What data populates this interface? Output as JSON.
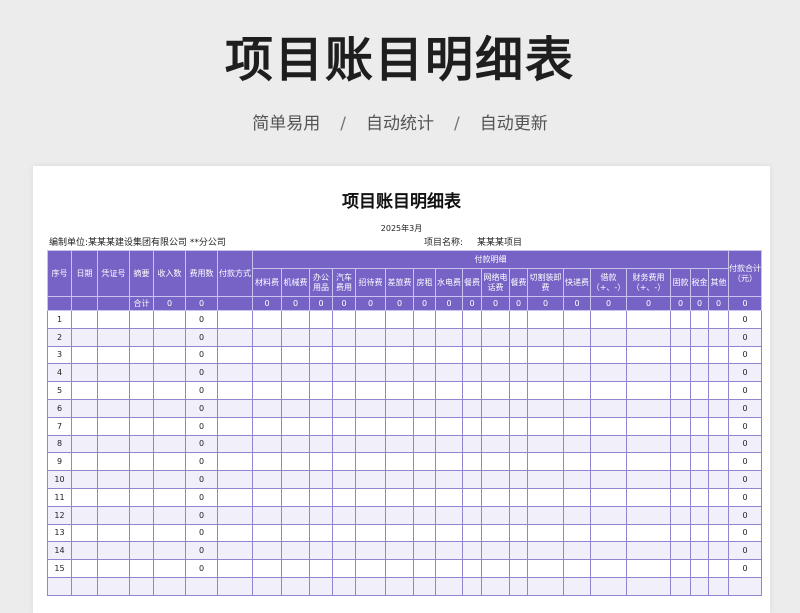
{
  "hero": {
    "title": "项目账目明细表",
    "tags": [
      "简单易用",
      "自动统计",
      "自动更新"
    ],
    "separator": "/"
  },
  "sheet": {
    "title": "项目账目明细表",
    "date": "2025年3月",
    "unit_label": "编制单位:某某某建设集团有限公司 **分公司",
    "project_label": "项目名称:",
    "project_value": "某某某项目"
  },
  "table": {
    "headers": {
      "seq": "序号",
      "date": "日期",
      "voucher": "凭证号",
      "summary": "摘要",
      "income": "收入数",
      "expense": "费用数",
      "pay_method": "付款方式",
      "detail_group": "付款明细",
      "pay_total": "付款合计（元）"
    },
    "detail_columns": [
      "材料费",
      "机械费",
      "办公用品",
      "汽车费用",
      "招待费",
      "差旅费",
      "房租",
      "水电费",
      "餐费",
      "网络电话费",
      "餐费",
      "切割装卸费",
      "快递费",
      "借款（+、-）",
      "财务费用（+、-）",
      "固款",
      "税金",
      "其他"
    ],
    "total_label": "合计",
    "total_values": {
      "income": "0",
      "expense": "0",
      "details": [
        "0",
        "0",
        "0",
        "0",
        "0",
        "0",
        "0",
        "0",
        "0",
        "0",
        "0",
        "0",
        "0",
        "0",
        "0",
        "0",
        "0",
        "0"
      ],
      "pay_total": "0"
    },
    "rows": [
      {
        "seq": "1",
        "expense": "0",
        "pay_total": "0"
      },
      {
        "seq": "2",
        "expense": "0",
        "pay_total": "0"
      },
      {
        "seq": "3",
        "expense": "0",
        "pay_total": "0"
      },
      {
        "seq": "4",
        "expense": "0",
        "pay_total": "0"
      },
      {
        "seq": "5",
        "expense": "0",
        "pay_total": "0"
      },
      {
        "seq": "6",
        "expense": "0",
        "pay_total": "0"
      },
      {
        "seq": "7",
        "expense": "0",
        "pay_total": "0"
      },
      {
        "seq": "8",
        "expense": "0",
        "pay_total": "0"
      },
      {
        "seq": "9",
        "expense": "0",
        "pay_total": "0"
      },
      {
        "seq": "10",
        "expense": "0",
        "pay_total": "0"
      },
      {
        "seq": "11",
        "expense": "0",
        "pay_total": "0"
      },
      {
        "seq": "12",
        "expense": "0",
        "pay_total": "0"
      },
      {
        "seq": "13",
        "expense": "0",
        "pay_total": "0"
      },
      {
        "seq": "14",
        "expense": "0",
        "pay_total": "0"
      },
      {
        "seq": "15",
        "expense": "0",
        "pay_total": "0"
      },
      {
        "seq": "",
        "expense": "",
        "pay_total": ""
      }
    ]
  },
  "colors": {
    "header_bg": "#7762c5",
    "grid_line": "#8f86d0",
    "row_alt": "#f1effa"
  }
}
